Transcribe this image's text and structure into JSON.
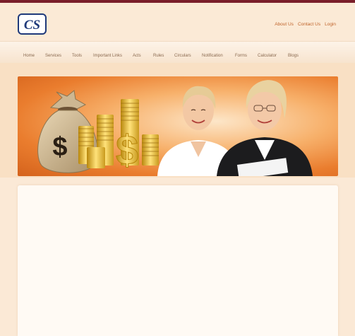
{
  "brand": {
    "logo_text": "CS"
  },
  "top_links": [
    "About Us",
    "Contact Us",
    "Login"
  ],
  "nav": [
    "Home",
    "Services",
    "Tools",
    "Important Links",
    "Acts",
    "Rules",
    "Circulars",
    "Notification",
    "Forms",
    "Calculator",
    "Blogs"
  ],
  "banner": {
    "money_bag_symbol": "$",
    "big_coin_symbol": "$"
  },
  "colors": {
    "accent": "#c0652c",
    "topbar": "#7a1e2a",
    "logo_blue": "#1f3a7a",
    "banner_orange": "#ea7d2e"
  }
}
